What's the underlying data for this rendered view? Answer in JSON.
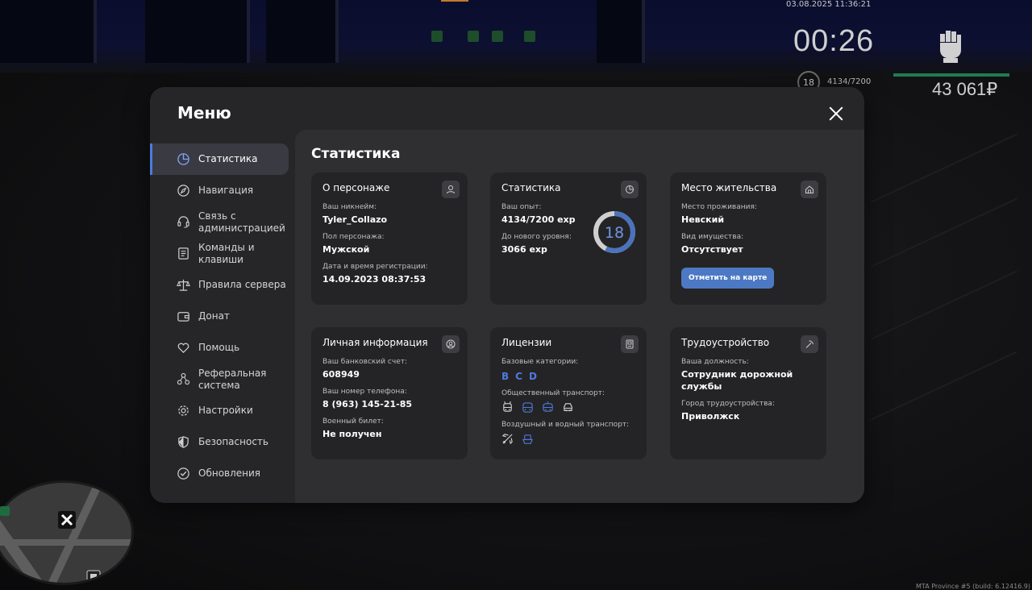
{
  "hud": {
    "datetime": "03.08.2025 11:36:21",
    "timer": "00:26",
    "level": "18",
    "exp": "4134/7200",
    "money": "43 061₽",
    "health_fraction": 1.0,
    "build": "MTA Province #5 (build: 6.12416.9)"
  },
  "menu": {
    "title": "Меню",
    "sidebar": [
      {
        "label": "Статистика",
        "icon": "pie-chart-icon",
        "active": true
      },
      {
        "label": "Навигация",
        "icon": "compass-icon",
        "active": false
      },
      {
        "label": "Связь с администрацией",
        "icon": "headset-icon",
        "active": false
      },
      {
        "label": "Команды и клавиши",
        "icon": "document-icon",
        "active": false
      },
      {
        "label": "Правила сервера",
        "icon": "scales-icon",
        "active": false
      },
      {
        "label": "Донат",
        "icon": "wallet-icon",
        "active": false
      },
      {
        "label": "Помощь",
        "icon": "heart-hand-icon",
        "active": false
      },
      {
        "label": "Реферальная система",
        "icon": "referral-icon",
        "active": false
      },
      {
        "label": "Настройки",
        "icon": "gear-icon",
        "active": false
      },
      {
        "label": "Безопасность",
        "icon": "shield-icon",
        "active": false
      },
      {
        "label": "Обновления",
        "icon": "check-circle-icon",
        "active": false
      }
    ],
    "content_title": "Статистика",
    "character": {
      "title": "О персонаже",
      "nick_label": "Ваш никнейм:",
      "nick": "Tyler_Collazo",
      "gender_label": "Пол персонажа:",
      "gender": "Мужской",
      "reg_label": "Дата и время регистрации:",
      "reg": "14.09.2023 08:37:53"
    },
    "stats": {
      "title": "Статистика",
      "exp_label": "Ваш опыт:",
      "exp": "4134/7200 exp",
      "next_label": "До нового уровня:",
      "next": "3066 exp",
      "level": "18",
      "progress": 0.574
    },
    "residence": {
      "title": "Место жительства",
      "place_label": "Место проживания:",
      "place": "Невский",
      "property_label": "Вид имущества:",
      "property": "Отсутствует",
      "map_button": "Отметить на карте"
    },
    "personal": {
      "title": "Личная информация",
      "bank_label": "Ваш банковский счет:",
      "bank": "608949",
      "phone_label": "Ваш номер телефона:",
      "phone": "8 (963) 145-21-85",
      "military_label": "Военный билет:",
      "military": "Не получен"
    },
    "licenses": {
      "title": "Лицензии",
      "base_label": "Базовые категории:",
      "categories": [
        "B",
        "C",
        "D"
      ],
      "public_label": "Общественный транспорт:",
      "air_label": "Воздушный и водный транспорт:"
    },
    "employment": {
      "title": "Трудоустройство",
      "position_label": "Ваша должность:",
      "position": "Сотрудник дорожной службы",
      "city_label": "Город трудоустройства:",
      "city": "Приволжск"
    }
  }
}
